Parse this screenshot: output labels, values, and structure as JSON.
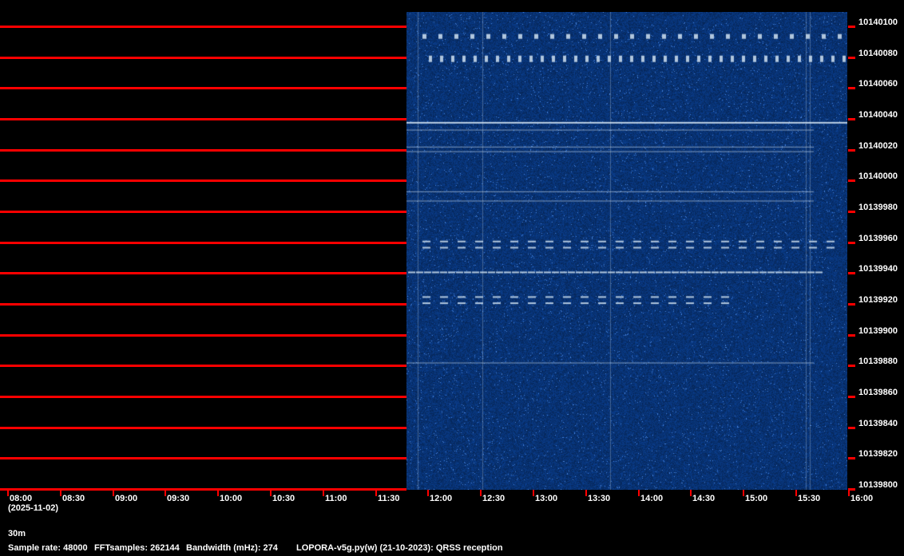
{
  "spectrogram": {
    "background_color": "#0b3a7a",
    "trace_color": "#cfe0f0",
    "axis_color": "#ff0000"
  },
  "frequency_axis": {
    "labels": [
      "10140100",
      "10140080",
      "10140060",
      "10140040",
      "10140020",
      "10140000",
      "10139980",
      "10139960",
      "10139940",
      "10139920",
      "10139900",
      "10139880",
      "10139860",
      "10139840",
      "10139820",
      "10139800"
    ]
  },
  "time_axis": {
    "labels": [
      "08:00",
      "08:30",
      "09:00",
      "09:30",
      "10:00",
      "10:30",
      "11:00",
      "11:30",
      "12:00",
      "12:30",
      "13:00",
      "13:30",
      "14:00",
      "14:30",
      "15:00",
      "15:30",
      "16:00"
    ],
    "date": "(2025-11-02)"
  },
  "footer": {
    "band": "30m",
    "sample_rate": "Sample rate: 48000",
    "fft_samples": "FFTsamples: 262144",
    "bandwidth": "Bandwidth (mHz): 274",
    "program": "LOPORA-v5g.py(w) (21-10-2023): QRSS reception"
  }
}
